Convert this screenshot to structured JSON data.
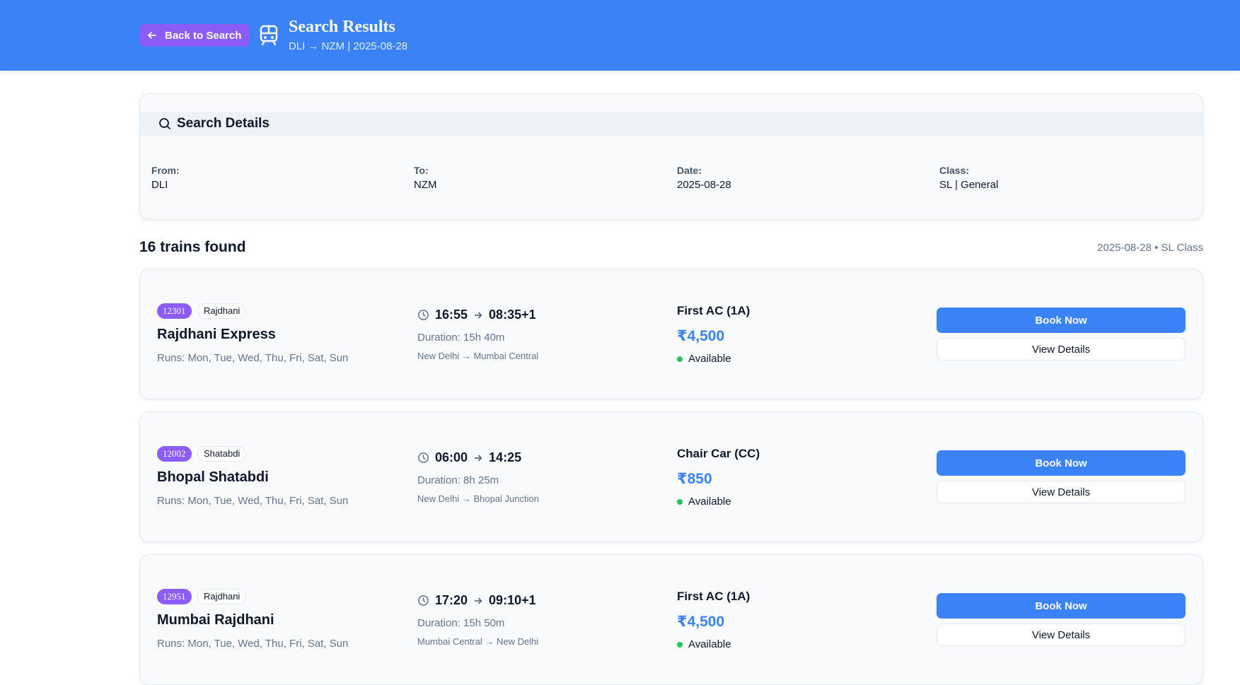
{
  "header": {
    "back_label": "Back to Search",
    "title": "Search Results",
    "subtitle": "DLI → NZM | 2025-08-28"
  },
  "search_details": {
    "heading": "Search Details",
    "fields": [
      {
        "label": "From:",
        "value": "DLI"
      },
      {
        "label": "To:",
        "value": "NZM"
      },
      {
        "label": "Date:",
        "value": "2025-08-28"
      },
      {
        "label": "Class:",
        "value": "SL | General"
      }
    ]
  },
  "results": {
    "count_text": "16 trains found",
    "meta_text": "2025-08-28 • SL Class"
  },
  "trains": [
    {
      "number": "12301",
      "type": "Rajdhani",
      "name": "Rajdhani Express",
      "runs": "Runs: Mon, Tue, Wed, Thu, Fri, Sat, Sun",
      "depart": "16:55",
      "arrive": "08:35+1",
      "duration": "Duration: 15h 40m",
      "route": "New Delhi → Mumbai Central",
      "class": "First AC (1A)",
      "price": "₹4,500",
      "availability": "Available",
      "book_label": "Book Now",
      "view_label": "View Details"
    },
    {
      "number": "12002",
      "type": "Shatabdi",
      "name": "Bhopal Shatabdi",
      "runs": "Runs: Mon, Tue, Wed, Thu, Fri, Sat, Sun",
      "depart": "06:00",
      "arrive": "14:25",
      "duration": "Duration: 8h 25m",
      "route": "New Delhi → Bhopal Junction",
      "class": "Chair Car (CC)",
      "price": "₹850",
      "availability": "Available",
      "book_label": "Book Now",
      "view_label": "View Details"
    },
    {
      "number": "12951",
      "type": "Rajdhani",
      "name": "Mumbai Rajdhani",
      "runs": "Runs: Mon, Tue, Wed, Thu, Fri, Sat, Sun",
      "depart": "17:20",
      "arrive": "09:10+1",
      "duration": "Duration: 15h 50m",
      "route": "Mumbai Central → New Delhi",
      "class": "First AC (1A)",
      "price": "₹4,500",
      "availability": "Available",
      "book_label": "Book Now",
      "view_label": "View Details"
    }
  ],
  "colors": {
    "header_bg": "#3b82f6",
    "accent_purple": "#8b5cf6",
    "price_blue": "#3b82f6",
    "available_green": "#22c55e"
  },
  "icons": [
    "arrow-left-icon",
    "train-icon",
    "search-icon",
    "clock-icon",
    "arrow-right-icon"
  ]
}
